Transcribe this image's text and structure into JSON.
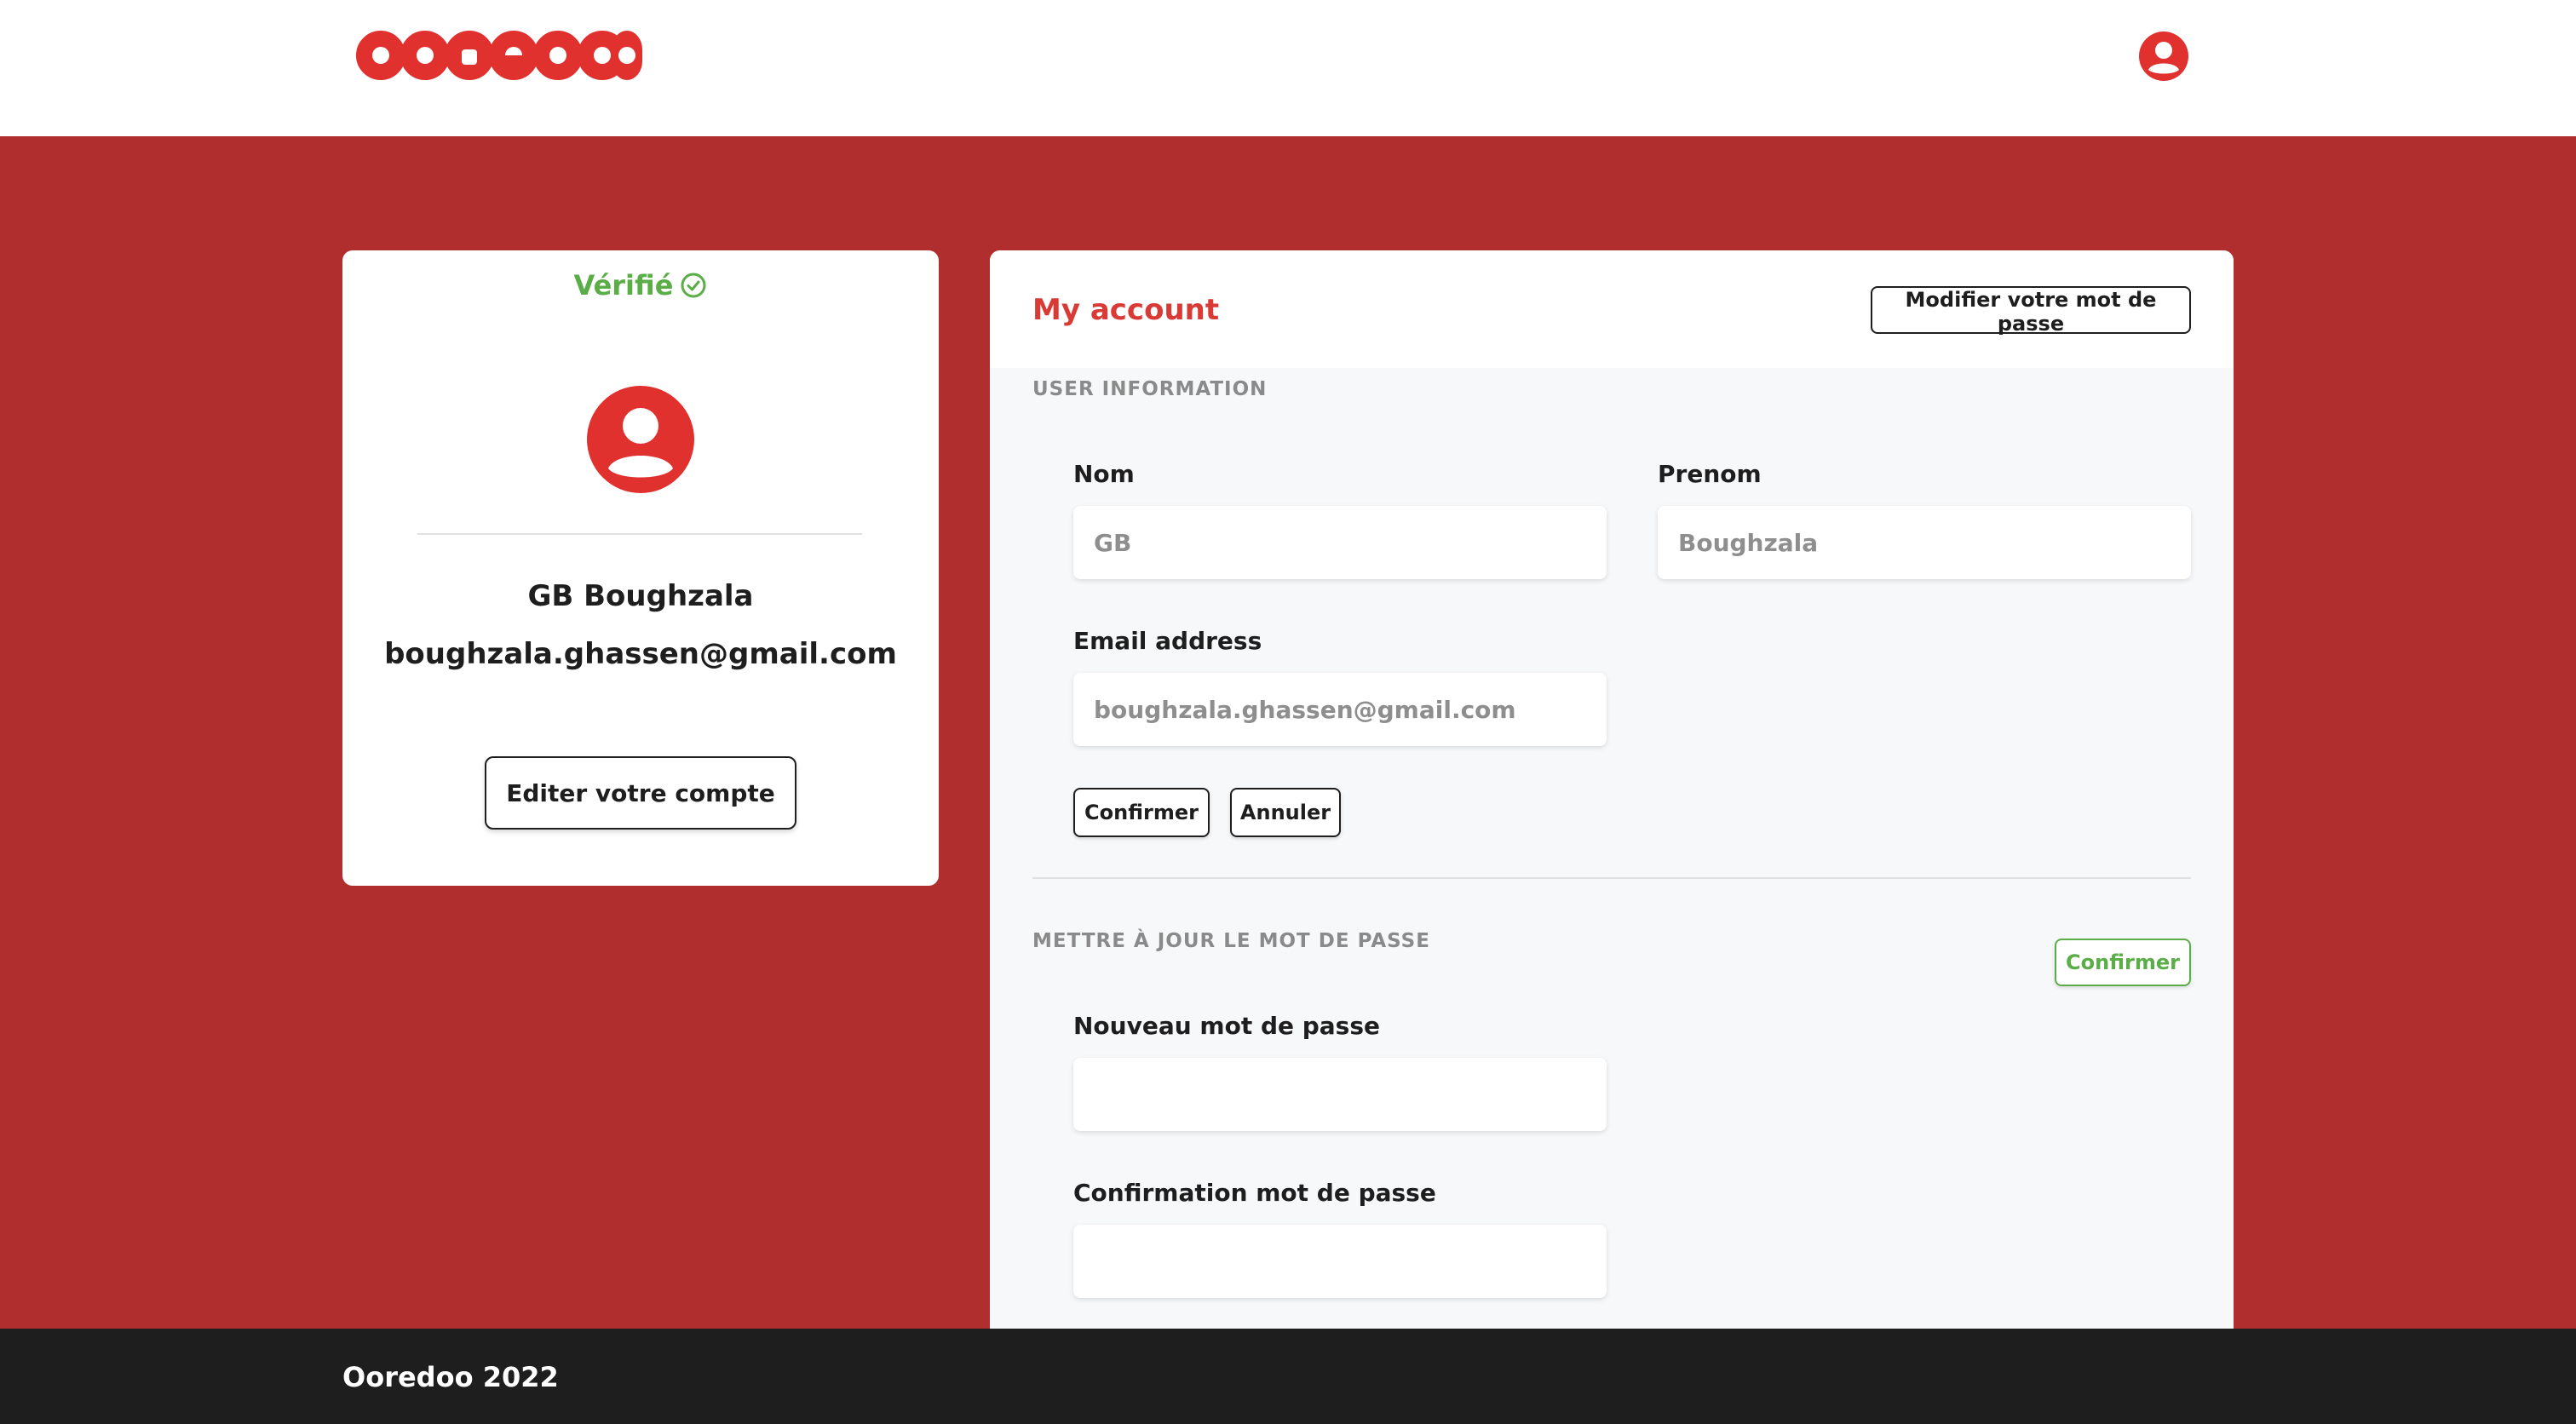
{
  "brand": {
    "logo_text": "ooredoo",
    "color": "#e0312f"
  },
  "header": {
    "user_icon": "user-circle-icon"
  },
  "profile": {
    "verified_label": "Vérifié",
    "verified_icon": "check-circle-icon",
    "avatar_icon": "user-avatar-icon",
    "name": "GB Boughzala",
    "email": "boughzala.ghassen@gmail.com",
    "edit_button": "Editer votre compte"
  },
  "account": {
    "title": "My account",
    "change_password_button": "Modifier votre mot de passe",
    "user_info": {
      "section_title": "USER INFORMATION",
      "nom_label": "Nom",
      "nom_placeholder": "GB",
      "prenom_label": "Prenom",
      "prenom_placeholder": "Boughzala",
      "email_label": "Email address",
      "email_placeholder": "boughzala.ghassen@gmail.com",
      "confirm_button": "Confirmer",
      "cancel_button": "Annuler"
    },
    "password": {
      "section_title": "METTRE À JOUR LE MOT DE PASSE",
      "confirm_button": "Confirmer",
      "new_label": "Nouveau mot de passe",
      "new_value": "",
      "confirm_label": "Confirmation mot de passe",
      "confirm_value": ""
    }
  },
  "footer": {
    "text": "Ooredoo 2022"
  },
  "colors": {
    "accent_red": "#b02e2e",
    "brand_red": "#e0312f",
    "verified_green": "#5aad47",
    "footer_bg": "#1e1e1f"
  }
}
